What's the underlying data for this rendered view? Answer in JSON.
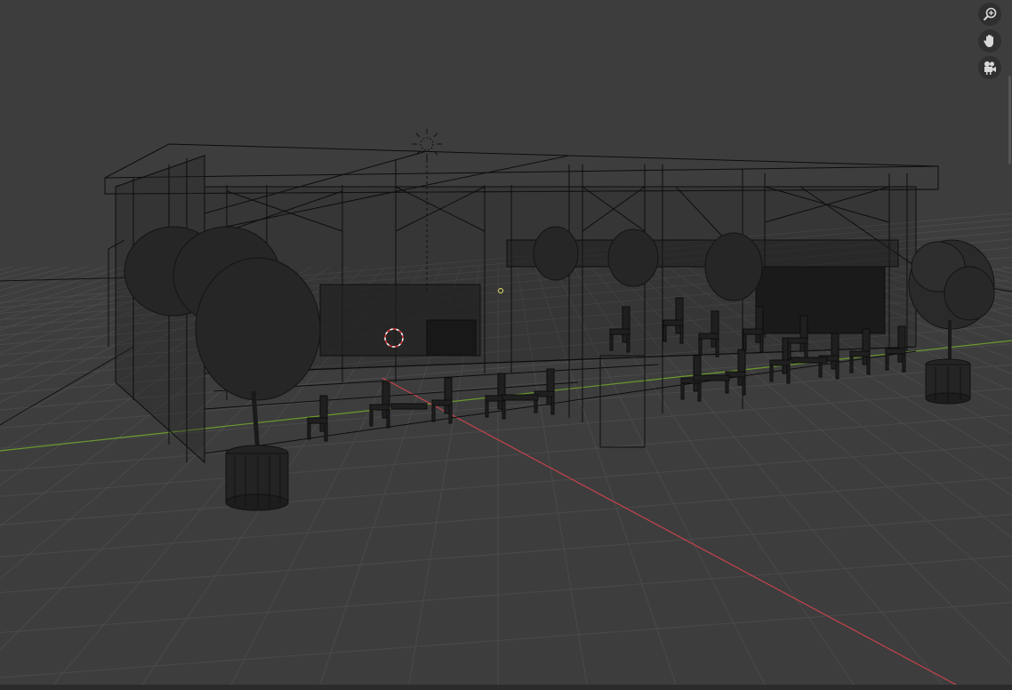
{
  "app": "3D Viewport",
  "viewport": {
    "shading_mode": "wireframe",
    "background_color": "#3d3d3d",
    "grid_color": "#4a4a4a",
    "x_axis_color": "#c4434b",
    "y_axis_color": "#6b9a2c",
    "wire_color": "#111111"
  },
  "navigation_gizmo": {
    "buttons": [
      {
        "name": "zoom",
        "icon": "magnifier-plus-icon"
      },
      {
        "name": "pan",
        "icon": "hand-icon"
      },
      {
        "name": "camera",
        "icon": "camera-icon"
      }
    ]
  },
  "scene_objects": [
    {
      "name": "cafe-structure",
      "icon": "wireframe-building"
    },
    {
      "name": "sun-lamp",
      "icon": "sun-lamp-icon"
    },
    {
      "name": "3d-cursor",
      "icon": "cursor-3d-icon"
    },
    {
      "name": "planter-tree-left",
      "icon": "tree-icon"
    },
    {
      "name": "planter-tree-right",
      "icon": "tree-icon"
    }
  ]
}
